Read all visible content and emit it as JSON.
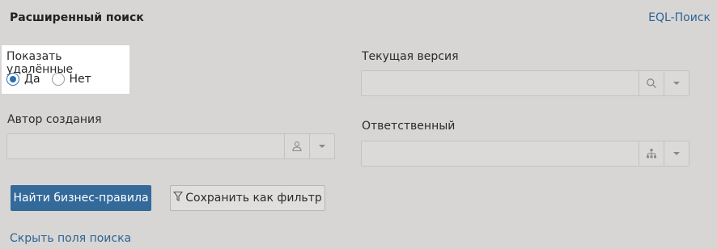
{
  "header": {
    "title": "Расширенный поиск",
    "eql_link": "EQL-Поиск"
  },
  "show_deleted": {
    "label": "Показать удалённые",
    "options": [
      {
        "label": "Да",
        "checked": true
      },
      {
        "label": "Нет",
        "checked": false
      }
    ]
  },
  "author": {
    "label": "Автор создания",
    "value": "",
    "icon": "person-icon"
  },
  "current_version": {
    "label": "Текущая версия",
    "value": "",
    "icon": "search-icon"
  },
  "responsible": {
    "label": "Ответственный",
    "value": "",
    "icon": "org-structure-icon"
  },
  "actions": {
    "find_label": "Найти бизнес-правила",
    "save_filter_label": "Сохранить как фильтр"
  },
  "footer": {
    "hide_fields_link": "Скрыть поля поиска"
  },
  "colors": {
    "background": "#d8d6d4",
    "primary": "#336a9a",
    "link": "#2a6496",
    "radio_accent": "#2a6db0"
  }
}
